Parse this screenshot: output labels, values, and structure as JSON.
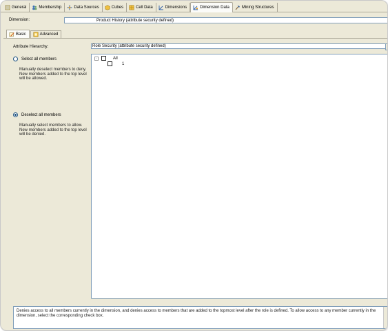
{
  "tabs": [
    {
      "label": "General",
      "icon": "general-icon"
    },
    {
      "label": "Membership",
      "icon": "membership-icon"
    },
    {
      "label": "Data Sources",
      "icon": "data-sources-icon"
    },
    {
      "label": "Cubes",
      "icon": "cubes-icon"
    },
    {
      "label": "Cell Data",
      "icon": "cell-data-icon"
    },
    {
      "label": "Dimensions",
      "icon": "dimensions-icon"
    },
    {
      "label": "Dimension Data",
      "icon": "dimension-data-icon",
      "active": true
    },
    {
      "label": "Mining Structures",
      "icon": "mining-structures-icon"
    }
  ],
  "dimension": {
    "label": "Dimension:",
    "value": "Product History (attribute security defined)"
  },
  "subtabs": [
    {
      "label": "Basic",
      "icon": "basic-icon",
      "active": true
    },
    {
      "label": "Advanced",
      "icon": "advanced-icon"
    }
  ],
  "attribute_hierarchy": {
    "label": "Attribute Hierarchy:",
    "value": "Role Security (attribute security defined)"
  },
  "options": {
    "select_all": {
      "label": "Select all members",
      "description": "Manually deselect members to deny. New members added to the top level will be allowed.",
      "checked": false
    },
    "deselect_all": {
      "label": "Deselect all members",
      "description": "Manually select members to allow. New members added to the top level will be denied.",
      "checked": true
    }
  },
  "tree": {
    "root": {
      "label": "All",
      "checked": false
    },
    "children": [
      {
        "label": "1",
        "checked": false
      }
    ]
  },
  "status_text": "Denies access to all members currently in the dimension, and denies access to members that are added to the topmost level after the role is defined. To allow access to any member currently in the dimension, select the corresponding check box."
}
